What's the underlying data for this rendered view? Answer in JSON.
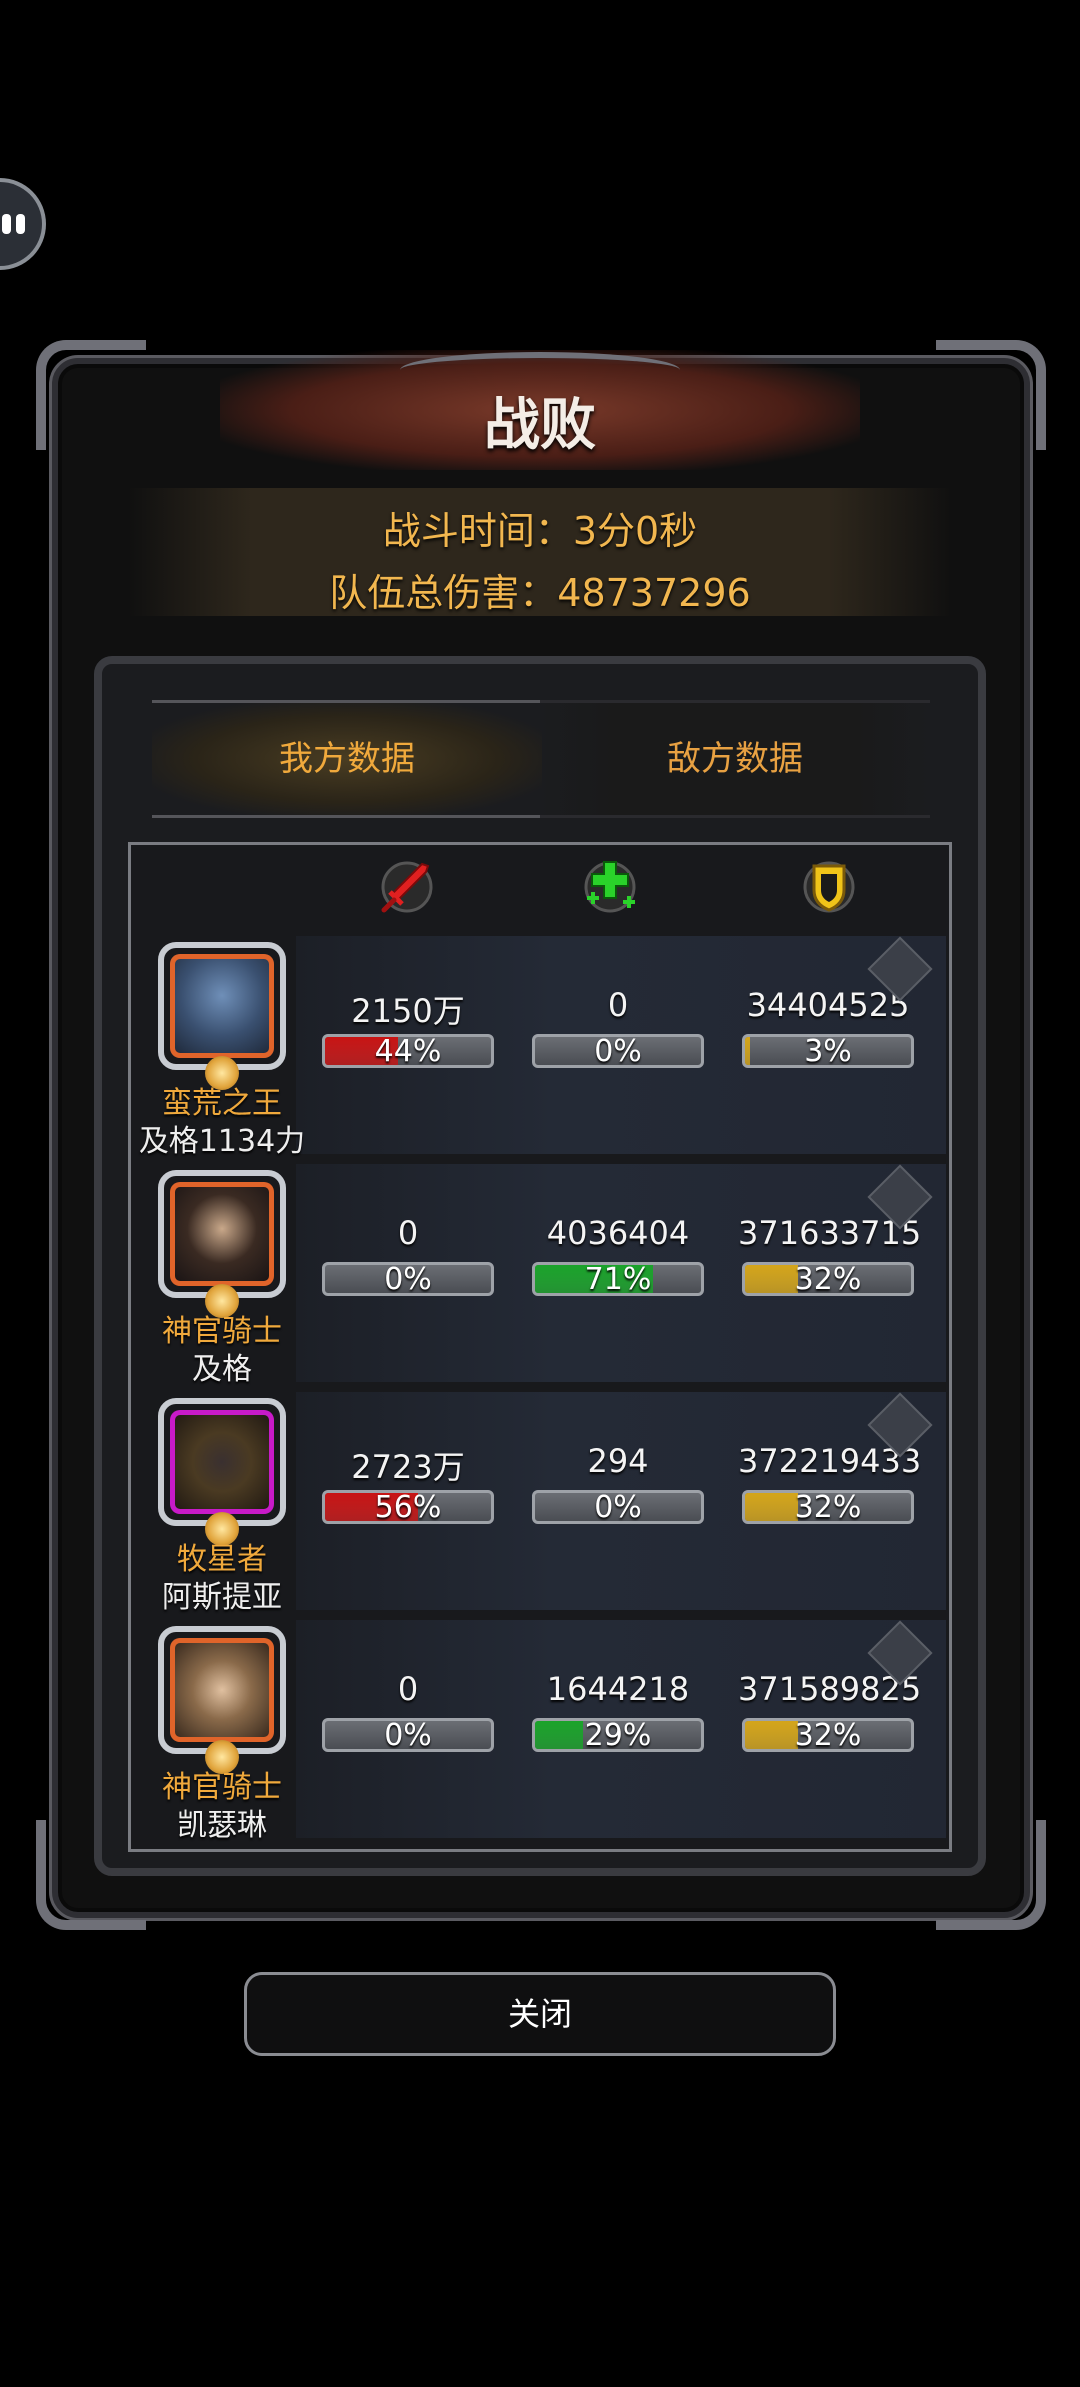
{
  "header": {
    "title": "战败",
    "battle_time": "战斗时间：3分0秒",
    "team_damage": "队伍总伤害：48737296"
  },
  "tabs": [
    {
      "label": "我方数据",
      "active": true
    },
    {
      "label": "敌方数据",
      "active": false
    }
  ],
  "columns": [
    {
      "icon": "sword-icon",
      "color": "#e02020"
    },
    {
      "icon": "heal-cross-icon",
      "color": "#29c42a"
    },
    {
      "icon": "shield-icon",
      "color": "#f0c419"
    }
  ],
  "rows": [
    {
      "class_name": "蛮荒之王",
      "player_name": "及格1134力",
      "damage": "2150万",
      "damage_pct": "44%",
      "damage_frac": 0.44,
      "heal": "0",
      "heal_pct": "0%",
      "heal_frac": 0,
      "taken": "34404525",
      "taken_pct": "3%",
      "taken_frac": 0.03,
      "portrait_frame": "#e0642a"
    },
    {
      "class_name": "神官骑士",
      "player_name": "及格",
      "damage": "0",
      "damage_pct": "0%",
      "damage_frac": 0,
      "heal": "4036404",
      "heal_pct": "71%",
      "heal_frac": 0.71,
      "taken": "371633715",
      "taken_pct": "32%",
      "taken_frac": 0.32,
      "portrait_frame": "#e0642a"
    },
    {
      "class_name": "牧星者",
      "player_name": "阿斯提亚",
      "damage": "2723万",
      "damage_pct": "56%",
      "damage_frac": 0.56,
      "heal": "294",
      "heal_pct": "0%",
      "heal_frac": 0,
      "taken": "372219433",
      "taken_pct": "32%",
      "taken_frac": 0.32,
      "portrait_frame": "#c81ac8"
    },
    {
      "class_name": "神官骑士",
      "player_name": "凯瑟琳",
      "damage": "0",
      "damage_pct": "0%",
      "damage_frac": 0,
      "heal": "1644218",
      "heal_pct": "29%",
      "heal_frac": 0.29,
      "taken": "371589825",
      "taken_pct": "32%",
      "taken_frac": 0.32,
      "portrait_frame": "#e0642a"
    }
  ],
  "footer": {
    "close_label": "关闭"
  },
  "colors": {
    "damage_fill": "#c81414",
    "heal_fill": "#1aa32a",
    "taken_fill": "#d4a51a"
  }
}
